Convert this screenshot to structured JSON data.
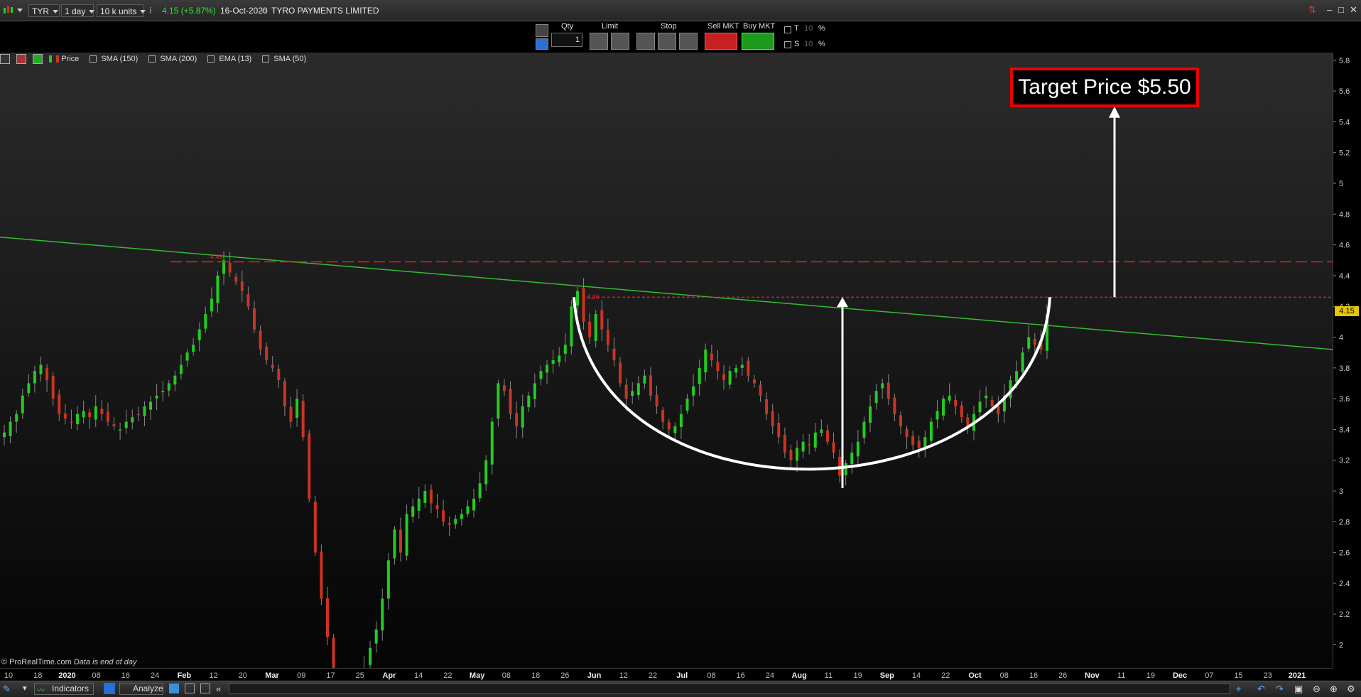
{
  "toolbar": {
    "symbol": "TYR",
    "timeframe": "1 day",
    "units": "10 k units",
    "price_change": "4.15 (+5.87%)",
    "date": "16-Oct-2020",
    "instrument": "TYRO PAYMENTS LIMITED"
  },
  "order": {
    "qty_label": "Qty",
    "qty_value": "1",
    "limit_label": "Limit",
    "stop_label": "Stop",
    "sell_label": "Sell MKT",
    "buy_label": "Buy MKT",
    "t_label": "T",
    "s_label": "S",
    "t_value": "10",
    "s_value": "10",
    "pct": "%"
  },
  "legend": {
    "price": "Price",
    "sma150": "SMA (150)",
    "sma200": "SMA (200)",
    "ema13": "EMA (13)",
    "sma50": "SMA (50)"
  },
  "annotations": {
    "target": "Target Price $5.50",
    "credit": "© ProRealTime.com",
    "credit_note": "Data is end of day",
    "last_price": "4.15",
    "high_label_1": "4.49",
    "high_label_2": "4.26"
  },
  "bottom": {
    "indicators": "Indicators",
    "analyze": "Analyze"
  },
  "colors": {
    "bull": "#22cc22",
    "bear": "#cc3322",
    "trend": "#33bb33",
    "resistance": "#dd2222",
    "accent": "#e6c700"
  },
  "chart_data": {
    "type": "candlestick",
    "ylim": [
      1.85,
      5.85
    ],
    "y_ticks": [
      "5.8",
      "5.6",
      "5.4",
      "5.2",
      "5",
      "4.8",
      "4.6",
      "4.4",
      "4.2",
      "4",
      "3.8",
      "3.6",
      "3.4",
      "3.2",
      "3",
      "2.8",
      "2.6",
      "2.4",
      "2.2",
      "2"
    ],
    "x_ticks": [
      "10",
      "18",
      "2020",
      "08",
      "16",
      "24",
      "Feb",
      "12",
      "20",
      "Mar",
      "09",
      "17",
      "25",
      "Apr",
      "14",
      "22",
      "May",
      "08",
      "18",
      "26",
      "Jun",
      "12",
      "22",
      "Jul",
      "08",
      "16",
      "24",
      "Aug",
      "11",
      "19",
      "Sep",
      "14",
      "22",
      "Oct",
      "08",
      "16",
      "26",
      "Nov",
      "11",
      "19",
      "Dec",
      "07",
      "15",
      "23",
      "2021"
    ],
    "resistance_levels": [
      4.49,
      4.26
    ],
    "target_price": 5.5,
    "cup_bottom": 3.0,
    "trendline": [
      {
        "x": "start",
        "y": 4.65
      },
      {
        "x": "end",
        "y": 3.92
      }
    ],
    "closes": [
      3.38,
      3.45,
      3.5,
      3.62,
      3.7,
      3.78,
      3.82,
      3.72,
      3.6,
      3.5,
      3.47,
      3.45,
      3.5,
      3.52,
      3.48,
      3.55,
      3.5,
      3.45,
      3.42,
      3.4,
      3.45,
      3.48,
      3.5,
      3.55,
      3.58,
      3.62,
      3.65,
      3.7,
      3.75,
      3.82,
      3.9,
      3.95,
      4.05,
      4.15,
      4.25,
      4.4,
      4.5,
      4.42,
      4.36,
      4.3,
      4.2,
      4.05,
      3.92,
      3.85,
      3.8,
      3.72,
      3.55,
      3.45,
      3.6,
      3.35,
      2.95,
      2.6,
      2.3,
      2.05,
      1.75,
      1.62,
      1.55,
      1.6,
      1.72,
      1.85,
      1.98,
      2.1,
      2.3,
      2.55,
      2.75,
      2.6,
      2.85,
      2.9,
      2.95,
      3.0,
      2.92,
      2.88,
      2.8,
      2.78,
      2.82,
      2.85,
      2.9,
      2.95,
      3.05,
      3.2,
      3.45,
      3.7,
      3.65,
      3.5,
      3.42,
      3.55,
      3.62,
      3.7,
      3.78,
      3.82,
      3.85,
      3.88,
      3.95,
      4.2,
      4.3,
      4.1,
      4.0,
      4.15,
      4.05,
      3.95,
      3.85,
      3.7,
      3.6,
      3.65,
      3.7,
      3.75,
      3.62,
      3.55,
      3.45,
      3.4,
      3.42,
      3.5,
      3.6,
      3.68,
      3.8,
      3.92,
      3.85,
      3.78,
      3.72,
      3.78,
      3.8,
      3.82,
      3.75,
      3.7,
      3.62,
      3.5,
      3.42,
      3.35,
      3.25,
      3.2,
      3.28,
      3.32,
      3.3,
      3.38,
      3.4,
      3.32,
      3.25,
      3.1,
      3.18,
      3.25,
      3.32,
      3.45,
      3.55,
      3.65,
      3.7,
      3.6,
      3.5,
      3.42,
      3.35,
      3.3,
      3.28,
      3.35,
      3.45,
      3.52,
      3.6,
      3.62,
      3.55,
      3.48,
      3.42,
      3.5,
      3.58,
      3.62,
      3.55,
      3.5,
      3.62,
      3.72,
      3.78,
      3.9,
      4.0,
      3.95,
      3.92,
      4.15
    ]
  }
}
